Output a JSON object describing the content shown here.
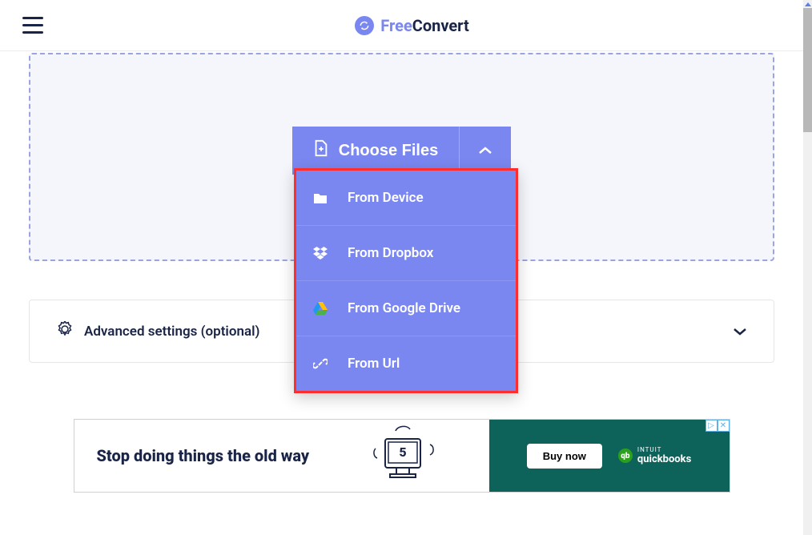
{
  "header": {
    "logo_free": "Free",
    "logo_convert": "Convert"
  },
  "upload": {
    "choose_label": "Choose Files",
    "sources": [
      {
        "label": "From Device",
        "icon": "folder-icon"
      },
      {
        "label": "From Dropbox",
        "icon": "dropbox-icon"
      },
      {
        "label": "From Google Drive",
        "icon": "gdrive-icon"
      },
      {
        "label": "From Url",
        "icon": "link-icon"
      }
    ]
  },
  "advanced": {
    "label": "Advanced settings (optional)"
  },
  "ad": {
    "headline": "Stop doing things the old way",
    "cta": "Buy now",
    "brand_top": "INTUIT",
    "brand": "quickbooks",
    "monitor_number": "5"
  }
}
